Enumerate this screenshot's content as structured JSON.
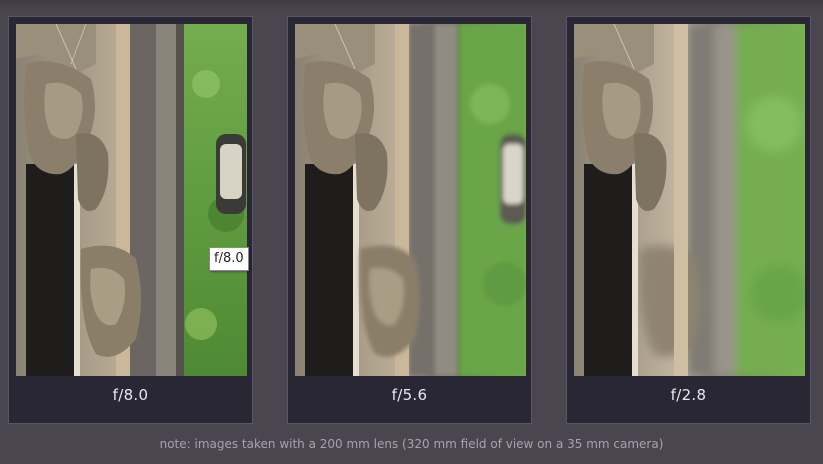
{
  "panels": [
    {
      "caption": "f/8.0"
    },
    {
      "caption": "f/5.6"
    },
    {
      "caption": "f/2.8"
    }
  ],
  "tooltip": {
    "text": "f/8.0"
  },
  "note": "note: images taken with a 200 mm lens (320 mm field of view on a 35 mm camera)",
  "colors": {
    "background": "#4a4650",
    "panel": "#2a2735",
    "caption_text": "#e8e6ee",
    "note_text": "#a7a3ae",
    "foliage": "#5f9a3e"
  }
}
